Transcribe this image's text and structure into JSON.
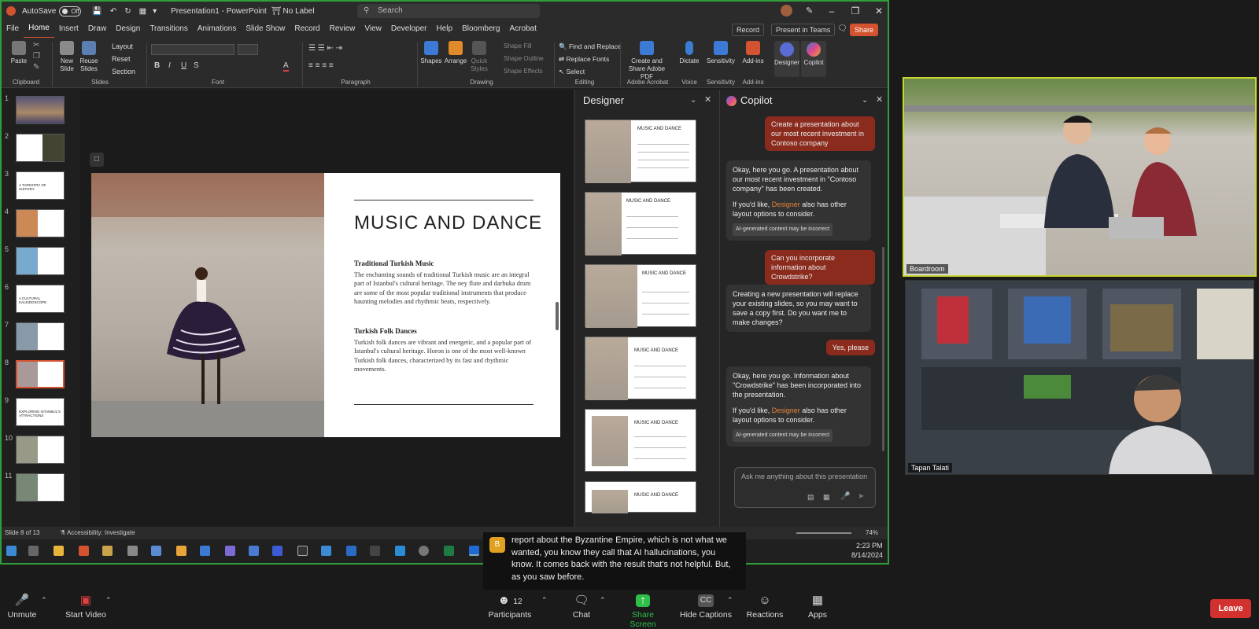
{
  "titlebar": {
    "autosave_label": "AutoSave",
    "autosave_state": "Off",
    "doc_title": "Presentation1 - PowerPoint",
    "label_badge": "No Label",
    "search_placeholder": "Search"
  },
  "menu": [
    "File",
    "Home",
    "Insert",
    "Draw",
    "Design",
    "Transitions",
    "Animations",
    "Slide Show",
    "Record",
    "Review",
    "View",
    "Developer",
    "Help",
    "Bloomberg",
    "Acrobat"
  ],
  "menu_buttons": {
    "record": "Record",
    "present": "Present in Teams",
    "share": "Share"
  },
  "ribbon": {
    "clipboard": {
      "paste": "Paste",
      "label": "Clipboard"
    },
    "slides": {
      "new_slide": "New Slide",
      "reuse": "Reuse Slides",
      "layout": "Layout",
      "reset": "Reset",
      "section": "Section",
      "label": "Slides"
    },
    "font_label": "Font",
    "paragraph_label": "Paragraph",
    "drawing": {
      "shapes": "Shapes",
      "arrange": "Arrange",
      "quick_styles": "Quick Styles",
      "shape_fill": "Shape Fill",
      "shape_outline": "Shape Outline",
      "shape_effects": "Shape Effects",
      "label": "Drawing"
    },
    "editing": {
      "find_replace": "Find and Replace",
      "replace_fonts": "Replace Fonts",
      "select": "Select",
      "label": "Editing"
    },
    "acrobat": {
      "create_share": "Create and Share Adobe PDF",
      "label": "Adobe Acrobat"
    },
    "voice": {
      "dictate": "Dictate",
      "label": "Voice"
    },
    "sensitivity": {
      "btn": "Sensitivity",
      "label": "Sensitivity"
    },
    "addins": {
      "btn": "Add-ins",
      "label": "Add-ins"
    },
    "designer_btn": "Designer",
    "copilot_btn": "Copilot"
  },
  "thumbnails": {
    "numbers": [
      "1",
      "2",
      "3",
      "4",
      "5",
      "6",
      "7",
      "8",
      "9",
      "10",
      "11"
    ],
    "texts": [
      "",
      "",
      "A TAPESTRY OF HISTORY",
      "",
      "",
      "A CULTURAL KALEIDOSCOPE",
      "",
      "",
      "EXPLORING ISTANBUL'S ATTRACTIONS",
      "",
      ""
    ]
  },
  "slide": {
    "title": "MUSIC AND DANCE",
    "h1": "Traditional Turkish Music",
    "p1": "The enchanting sounds of traditional Turkish music are an integral part of Istanbul's cultural heritage. The ney flute and darbuka drum are some of the most popular traditional instruments that produce haunting melodies and rhythmic beats, respectively.",
    "h2": "Turkish Folk Dances",
    "p2": "Turkish folk dances are vibrant and energetic, and a popular part of Istanbul's cultural heritage. Horon is one of the most well-known Turkish folk dances, characterized by its fast and rhythmic movements."
  },
  "designer": {
    "title": "Designer",
    "card_title": "MUSIC AND DANCE"
  },
  "copilot": {
    "title": "Copilot",
    "msg1_user": "Create a presentation about our most recent investment in Contoso company",
    "msg2_bot": "Okay, here you go. A presentation about our most recent investment in \"Contoso company\" has been created.",
    "msg2_more_pre": "If you'd like, ",
    "designer_word": "Designer",
    "msg2_more_post": " also has other layout options to consider.",
    "ai_tag": "AI-generated content may be incorrect",
    "msg3_user": "Can you incorporate information about Crowdstrike?",
    "msg4_bot": "Creating a new presentation will replace your existing slides, so you may want to save a copy first. Do you want me to make changes?",
    "msg5_user": "Yes, please",
    "msg6_bot": "Okay, here you go. Information about \"Crowdstrike\" has been incorporated into the presentation.",
    "ask_placeholder": "Ask me anything about this presentation"
  },
  "statusbar": {
    "slide_of": "Slide 8 of 13",
    "accessibility": "Accessibility: Investigate",
    "zoom": "74%"
  },
  "taskbar": {
    "time": "2:23 PM",
    "date": "8/14/2024"
  },
  "video_tiles": [
    {
      "name": "Boardroom"
    },
    {
      "name": "Tapan Talati"
    }
  ],
  "caption": {
    "avatar": "B",
    "text": "report about the Byzantine Empire, which is not what we wanted, you know they call that AI hallucinations, you know. It comes back with the result that's not helpful. But, as you saw before."
  },
  "zoom_controls": {
    "unmute": "Unmute",
    "start_video": "Start Video",
    "participants": "Participants",
    "participants_count": "12",
    "chat": "Chat",
    "share_screen": "Share Screen",
    "hide_captions": "Hide Captions",
    "reactions": "Reactions",
    "apps": "Apps",
    "leave": "Leave"
  },
  "colors": {
    "accent_powerpoint": "#d35230",
    "share_green": "#2f9e3b",
    "leave_red": "#d1322f",
    "copilot_user_bubble": "#8a2b1e",
    "designer_link": "#e8843b"
  }
}
